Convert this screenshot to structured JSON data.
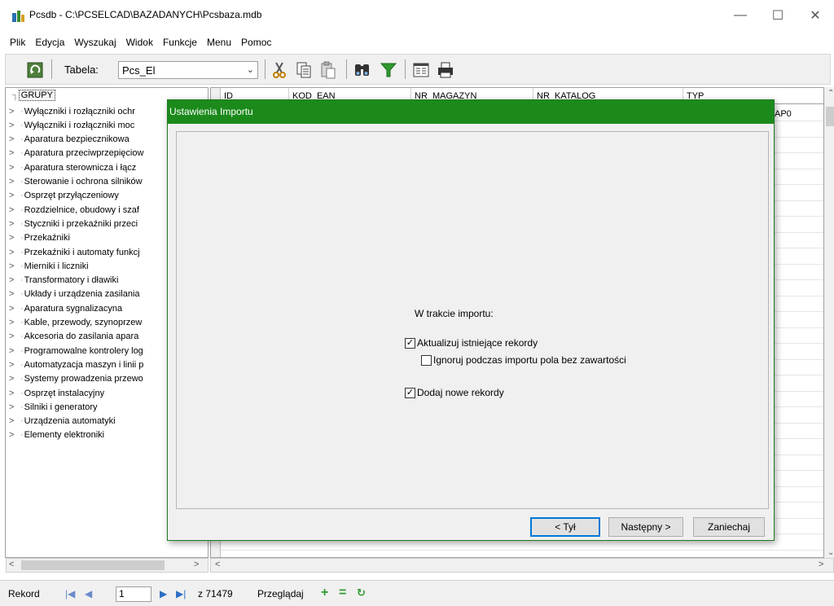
{
  "window": {
    "title": "Pcsdb - C:\\PCSELCAD\\BAZADANYCH\\Pcsbaza.mdb",
    "minimize_glyph": "—",
    "maximize_glyph": "☐",
    "close_glyph": "✕"
  },
  "menu": {
    "items": [
      "Plik",
      "Edycja",
      "Wyszukaj",
      "Widok",
      "Funkcje",
      "Menu",
      "Pomoc"
    ]
  },
  "toolbar": {
    "table_label": "Tabela:",
    "table_value": "Pcs_El",
    "icons": [
      "refresh-icon",
      "cut-icon",
      "copy-icon",
      "paste-icon",
      "find-icon",
      "filter-icon",
      "form-icon",
      "print-icon"
    ]
  },
  "tree": {
    "root_label": "GRUPY",
    "items": [
      "Wyłączniki i rozłączniki ochr",
      "Wyłączniki i rozłączniki moc",
      "Aparatura bezpiecznikowa",
      "Aparatura przeciwprzepięciow",
      "Aparatura sterownicza i łącz",
      "Sterowanie i ochrona silników",
      "Osprzęt przyłączeniowy",
      "Rozdzielnice, obudowy i szaf",
      "Styczniki i przekaźniki przeci",
      "Przekaźniki",
      "Przekaźniki i automaty funkcj",
      "Mierniki i liczniki",
      "Transformatory i dławiki",
      "Układy i urządzenia zasilania",
      "Aparatura sygnalizacyna",
      "Kable, przewody, szynoprzew",
      "Akcesoria do zasilania apara",
      "Programowalne kontrolery log",
      "Automatyzacja maszyn i linii p",
      "Systemy prowadzenia przewo",
      "Osprzęt instalacyjny",
      "Silniki i generatory",
      "Urządzenia automatyki",
      "Elementy elektroniki"
    ]
  },
  "grid": {
    "columns": [
      "ID",
      "KOD_EAN",
      "NR_MAGAZYN",
      "NR_KATALOG",
      "TYP"
    ],
    "first_row_typ": "AP0"
  },
  "status": {
    "record_label": "Rekord",
    "record_value": "1",
    "record_count": "z 71479",
    "browse_label": "Przeglądaj"
  },
  "dialog": {
    "title": "Ustawienia Importu",
    "during_import_label": "W trakcie importu:",
    "option_update": {
      "label": "Aktualizuj istniejące rekordy",
      "checked": true
    },
    "option_ignore_empty": {
      "label": "Ignoruj podczas importu pola bez zawartości",
      "checked": false
    },
    "option_add_new": {
      "label": "Dodaj nowe rekordy",
      "checked": true
    },
    "back_button": "< Tył",
    "next_button": "Następny >",
    "cancel_button": "Zaniechaj"
  },
  "colors": {
    "dialog_title_bg": "#1b8a1b",
    "focus_border": "#0078d7"
  }
}
